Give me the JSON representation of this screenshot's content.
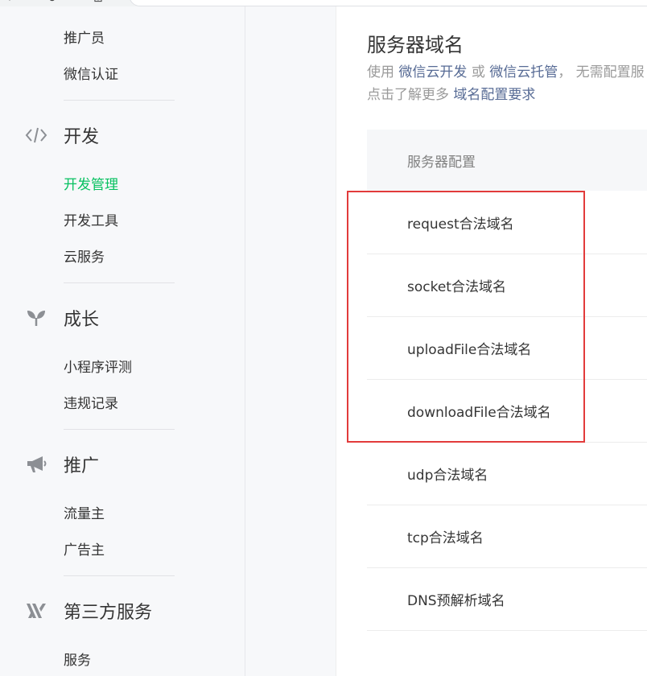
{
  "sidebar": {
    "account_items": [
      "推广员",
      "微信认证"
    ],
    "sections": [
      {
        "title": "开发",
        "icon": "code-icon",
        "items": [
          "开发管理",
          "开发工具",
          "云服务"
        ],
        "active_index": 0
      },
      {
        "title": "成长",
        "icon": "sprout-icon",
        "items": [
          "小程序评测",
          "违规记录"
        ]
      },
      {
        "title": "推广",
        "icon": "megaphone-icon",
        "items": [
          "流量主",
          "广告主"
        ]
      },
      {
        "title": "第三方服务",
        "icon": "third-party-icon",
        "items": [
          "服务"
        ]
      }
    ]
  },
  "main": {
    "title": "服务器域名",
    "desc_line1_prefix": "使用",
    "desc_link1": "微信云开发",
    "desc_or": "或",
    "desc_link2": "微信云托管",
    "desc_line1_suffix": "， 无需配置服",
    "desc_line2_prefix": "点击了解更多",
    "desc_link3": "域名配置要求",
    "table_header": "服务器配置",
    "rows": [
      "request合法域名",
      "socket合法域名",
      "uploadFile合法域名",
      "downloadFile合法域名",
      "udp合法域名",
      "tcp合法域名",
      "DNS预解析域名"
    ]
  },
  "colors": {
    "active_nav": "#07c160",
    "link": "#576b95",
    "highlight_box": "#e23b3b"
  }
}
